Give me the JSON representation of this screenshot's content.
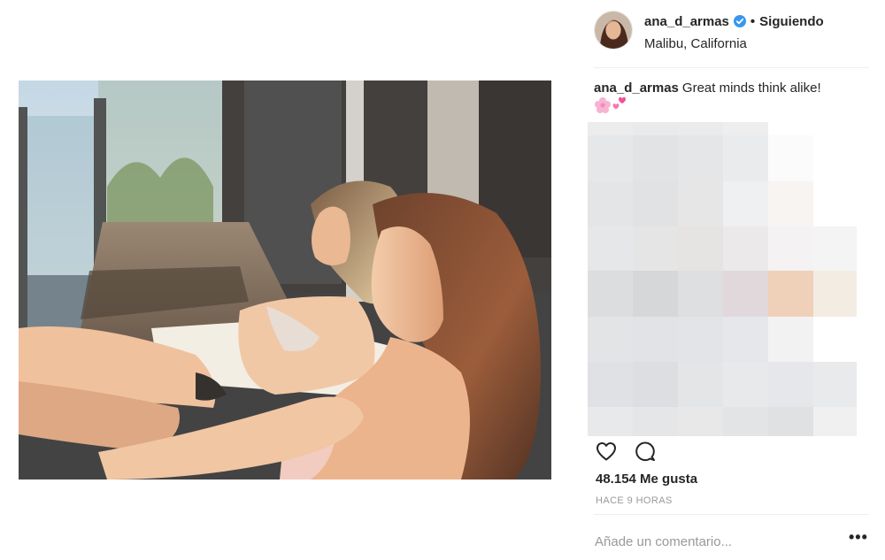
{
  "post": {
    "photo_icon": "post-photo",
    "author": {
      "username": "ana_d_armas",
      "verified_icon": "verified-badge-icon",
      "separator": "•",
      "follow_status": "Siguiendo",
      "location": "Malibu, California"
    },
    "caption": {
      "username": "ana_d_armas",
      "text": "Great minds think alike!",
      "emojis": [
        "cherry-blossom-emoji",
        "two-hearts-emoji"
      ]
    },
    "actions": {
      "like_icon": "heart-icon",
      "comment_icon": "comment-icon"
    },
    "likes_text": "48.154 Me gusta",
    "timestamp": "HACE 9 HORAS",
    "comment": {
      "placeholder": "Añade un comentario...",
      "value": ""
    },
    "more_options": "•••",
    "colors": {
      "text": "#262626",
      "muted": "#999999",
      "divider": "#efefef",
      "verified": "#3897f0"
    }
  }
}
